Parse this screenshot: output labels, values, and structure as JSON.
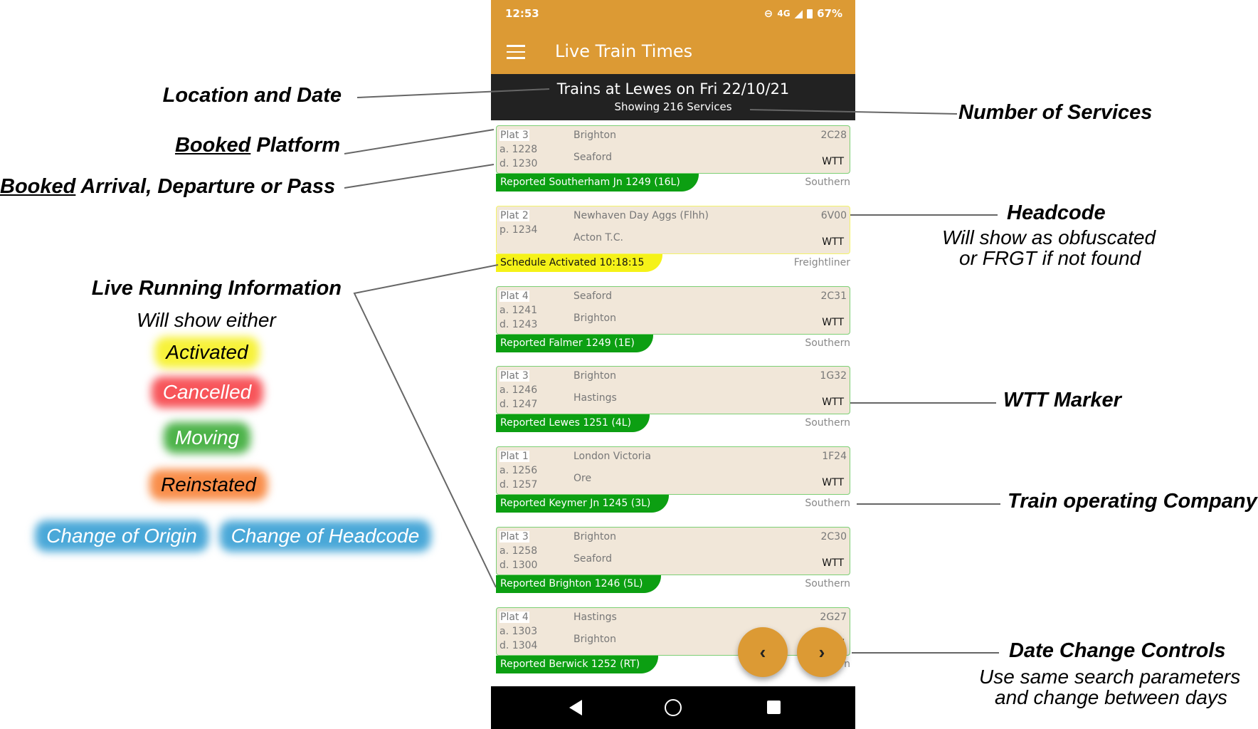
{
  "status_bar": {
    "time": "12:53",
    "network": "4G",
    "battery": "67%"
  },
  "app": {
    "title": "Live Train Times"
  },
  "header": {
    "location_date": "Trains at Lewes on Fri 22/10/21",
    "count": "Showing 216 Services"
  },
  "services": [
    {
      "plat": "Plat 3",
      "t1": "a. 1228",
      "t2": "d. 1230",
      "origin": "Brighton",
      "dest": "Seaford",
      "headcode": "2C28",
      "wtt": "WTT",
      "status": "Reported Southerham Jn 1249 (16L)",
      "status_type": "moving",
      "toc": "Southern"
    },
    {
      "plat": "Plat 2",
      "t1": "p. 1234",
      "t2": "",
      "origin": "Newhaven Day Aggs (Flhh)",
      "dest": "Acton T.C.",
      "headcode": "6V00",
      "wtt": "WTT",
      "status": "Schedule Activated 10:18:15",
      "status_type": "activated",
      "toc": "Freightliner"
    },
    {
      "plat": "Plat 4",
      "t1": "a. 1241",
      "t2": "d. 1243",
      "origin": "Seaford",
      "dest": "Brighton",
      "headcode": "2C31",
      "wtt": "WTT",
      "status": "Reported Falmer 1249 (1E)",
      "status_type": "moving",
      "toc": "Southern"
    },
    {
      "plat": "Plat 3",
      "t1": "a. 1246",
      "t2": "d. 1247",
      "origin": "Brighton",
      "dest": "Hastings",
      "headcode": "1G32",
      "wtt": "WTT",
      "status": "Reported Lewes 1251 (4L)",
      "status_type": "moving",
      "toc": "Southern"
    },
    {
      "plat": "Plat 1",
      "t1": "a. 1256",
      "t2": "d. 1257",
      "origin": "London Victoria",
      "dest": "Ore",
      "headcode": "1F24",
      "wtt": "WTT",
      "status": "Reported Keymer Jn 1245 (3L)",
      "status_type": "moving",
      "toc": "Southern"
    },
    {
      "plat": "Plat 3",
      "t1": "a. 1258",
      "t2": "d. 1300",
      "origin": "Brighton",
      "dest": "Seaford",
      "headcode": "2C30",
      "wtt": "WTT",
      "status": "Reported Brighton 1246 (5L)",
      "status_type": "moving",
      "toc": "Southern"
    },
    {
      "plat": "Plat 4",
      "t1": "a. 1303",
      "t2": "d. 1304",
      "origin": "Hastings",
      "dest": "Brighton",
      "headcode": "2G27",
      "wtt": "WTT",
      "status": "Reported Berwick 1252 (RT)",
      "status_type": "moving",
      "toc": "Southern"
    }
  ],
  "fab": {
    "prev": "‹",
    "next": "›"
  },
  "annotations": {
    "location_date": "Location and Date",
    "booked_platform_u": "Booked",
    "booked_platform": " Platform",
    "booked_times_u": "Booked",
    "booked_times": " Arrival, Departure or Pass",
    "live_running": "Live Running Information",
    "will_show": "Will show either",
    "states": [
      {
        "label": "Activated",
        "color": "#f7f23a",
        "text_color": "#000000"
      },
      {
        "label": "Cancelled",
        "color": "#f7555a",
        "text_color": "#ffffff"
      },
      {
        "label": "Moving",
        "color": "#4db34a",
        "text_color": "#ffffff"
      },
      {
        "label": "Reinstated",
        "color": "#f98e4a",
        "text_color": "#000000"
      },
      {
        "label": "Change of Origin",
        "color": "#4aa8d8",
        "text_color": "#ffffff"
      },
      {
        "label": "Change of Headcode",
        "color": "#4aa8d8",
        "text_color": "#ffffff"
      }
    ],
    "num_services": "Number of Services",
    "headcode": "Headcode",
    "headcode_sub1": "Will show as obfuscated",
    "headcode_sub2": "or FRGT if not found",
    "wtt_marker": "WTT Marker",
    "toc": "Train operating Company",
    "date_controls": "Date Change Controls",
    "date_sub1": "Use same search parameters",
    "date_sub2": "and change between days"
  },
  "colors": {
    "accent": "#dc9a34",
    "header": "#222222",
    "card": "#f1e7d9",
    "moving": "#0c9f12",
    "activated": "#f5f218"
  }
}
